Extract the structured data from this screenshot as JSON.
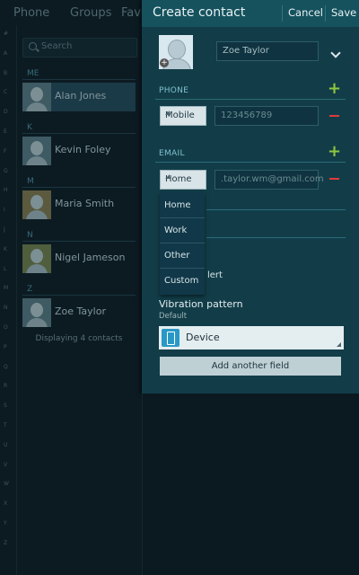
{
  "background": {
    "tabs": [
      "Phone",
      "Groups",
      "Favo"
    ],
    "search_placeholder": "Search",
    "index_letters": [
      "#",
      "A",
      "B",
      "C",
      "D",
      "E",
      "F",
      "G",
      "H",
      "I",
      "J",
      "K",
      "L",
      "M",
      "N",
      "O",
      "P",
      "Q",
      "R",
      "S",
      "T",
      "U",
      "V",
      "W",
      "X",
      "Y",
      "Z"
    ],
    "sections": [
      {
        "header": "ME",
        "contacts": [
          {
            "name": "Alan Jones",
            "selected": true
          }
        ]
      },
      {
        "header": "K",
        "contacts": [
          {
            "name": "Kevin Foley"
          }
        ]
      },
      {
        "header": "M",
        "contacts": [
          {
            "name": "Maria Smith"
          }
        ]
      },
      {
        "header": "N",
        "contacts": [
          {
            "name": "Nigel Jameson"
          }
        ]
      },
      {
        "header": "Z",
        "contacts": [
          {
            "name": "Zoe Taylor"
          }
        ]
      }
    ],
    "displaying": "Displaying 4 contacts"
  },
  "panel": {
    "title": "Create contact",
    "cancel_label": "Cancel",
    "save_label": "Save",
    "name_value": "Zoe Taylor",
    "phone": {
      "header": "PHONE",
      "type": "Mobile",
      "value": "123456789"
    },
    "email": {
      "header": "EMAIL",
      "type": "Home",
      "value": ".taylor.wm@gmail.com"
    },
    "email_type_options": [
      "Home",
      "Work",
      "Other",
      "Custom"
    ],
    "partial_alert_text": "lert",
    "vibration": {
      "title": "Vibration pattern",
      "subtitle": "Default",
      "selected": "Device"
    },
    "add_field_label": "Add another field"
  },
  "colors": {
    "accent_plus": "#8ec73d",
    "accent_minus": "#e03a3a",
    "panel_bg": "#123d48",
    "topbar_bg": "#15525e"
  },
  "icons": [
    "search-icon",
    "contact-avatar-icon",
    "add-photo-icon",
    "chevron-down-icon",
    "plus-icon",
    "minus-icon",
    "phone-device-icon"
  ]
}
